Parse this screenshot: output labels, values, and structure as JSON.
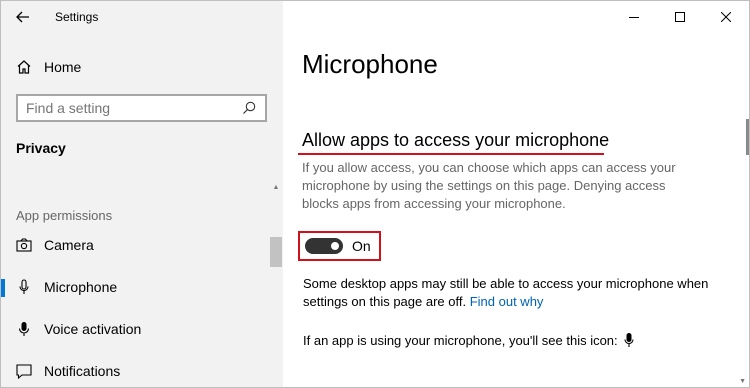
{
  "app": {
    "title": "Settings"
  },
  "window_controls": {
    "minimize": "—",
    "maximize": "☐",
    "close": "✕"
  },
  "sidebar": {
    "home_label": "Home",
    "search_placeholder": "Find a setting",
    "section_title": "Privacy",
    "group_label": "App permissions",
    "items": [
      {
        "label": "Camera",
        "icon": "camera-icon",
        "selected": false
      },
      {
        "label": "Microphone",
        "icon": "microphone-icon",
        "selected": true
      },
      {
        "label": "Voice activation",
        "icon": "voice-activation-icon",
        "selected": false
      },
      {
        "label": "Notifications",
        "icon": "notifications-icon",
        "selected": false
      }
    ]
  },
  "main": {
    "title": "Microphone",
    "section_heading": "Allow apps to access your microphone",
    "description": "If you allow access, you can choose which apps can access your microphone by using the settings on this page. Denying access blocks apps from accessing your microphone.",
    "toggle": {
      "state": "On",
      "on": true
    },
    "note": "Some desktop apps may still be able to access your microphone when settings on this page are off.",
    "note_link": "Find out why",
    "icon_line": "If an app is using your microphone, you'll see this icon:"
  },
  "colors": {
    "accent": "#0078d7",
    "highlight": "#d0111b",
    "link": "#0063b1",
    "sidebar_bg": "#f2f2f2"
  }
}
